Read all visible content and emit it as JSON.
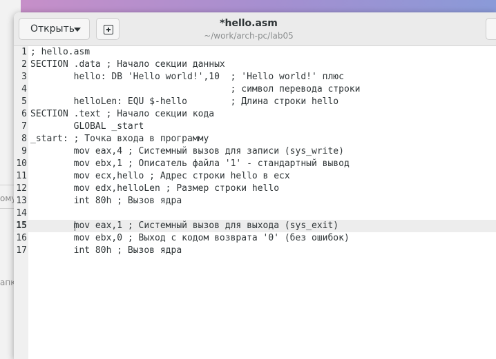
{
  "background": {
    "fragments": [
      "ому",
      "апка"
    ]
  },
  "headerbar": {
    "open_label": "Открыть",
    "title": "*hello.asm",
    "subtitle": "~/work/arch-pc/lab05"
  },
  "editor": {
    "current_line": 15,
    "lines": [
      {
        "no": "1",
        "text": "; hello.asm"
      },
      {
        "no": "2",
        "text": "SECTION .data ; Начало секции данных"
      },
      {
        "no": "3",
        "text": "        hello: DB 'Hello world!',10  ; 'Hello world!' плюс"
      },
      {
        "no": "4",
        "text": "                                     ; символ перевода строки"
      },
      {
        "no": "5",
        "text": "        helloLen: EQU $-hello        ; Длина строки hello"
      },
      {
        "no": "6",
        "text": "SECTION .text ; Начало секции кода"
      },
      {
        "no": "7",
        "text": "        GLOBAL _start"
      },
      {
        "no": "8",
        "text": "_start: ; Точка входа в программу"
      },
      {
        "no": "9",
        "text": "        mov eax,4 ; Системный вызов для записи (sys_write)"
      },
      {
        "no": "10",
        "text": "        mov ebx,1 ; Описатель файла '1' - стандартный вывод"
      },
      {
        "no": "11",
        "text": "        mov ecx,hello ; Адрес строки hello в ecx"
      },
      {
        "no": "12",
        "text": "        mov edx,helloLen ; Размер строки hello"
      },
      {
        "no": "13",
        "text": "        int 80h ; Вызов ядра"
      },
      {
        "no": "14",
        "text": ""
      },
      {
        "no": "15",
        "text": "        mov eax,1 ; Системный вызов для выхода (sys_exit)"
      },
      {
        "no": "16",
        "text": "        mov ebx,0 ; Выход с кодом возврата '0' (без ошибок)"
      },
      {
        "no": "17",
        "text": "        int 80h ; Вызов ядра"
      }
    ]
  }
}
